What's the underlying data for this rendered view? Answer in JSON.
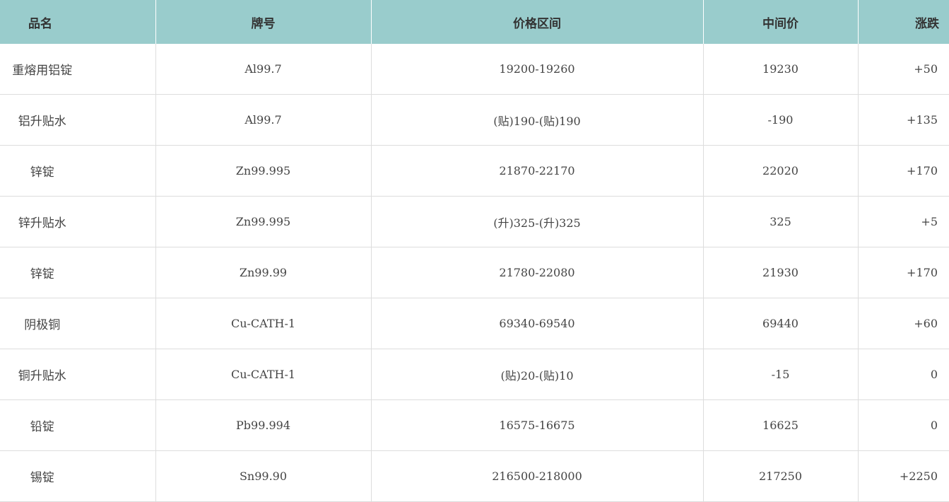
{
  "table": {
    "headers": {
      "name": "品名",
      "grade": "牌号",
      "range": "价格区间",
      "mid": "中间价",
      "change": "涨跌"
    },
    "rows": [
      {
        "name": "重熔用铝锭",
        "grade": "Al99.7",
        "range": "19200-19260",
        "mid": "19230",
        "change": "+50"
      },
      {
        "name": "铝升贴水",
        "grade": "Al99.7",
        "range": "(贴)190-(贴)190",
        "mid": "-190",
        "change": "+135"
      },
      {
        "name": "锌锭",
        "grade": "Zn99.995",
        "range": "21870-22170",
        "mid": "22020",
        "change": "+170"
      },
      {
        "name": "锌升贴水",
        "grade": "Zn99.995",
        "range": "(升)325-(升)325",
        "mid": "325",
        "change": "+5"
      },
      {
        "name": "锌锭",
        "grade": "Zn99.99",
        "range": "21780-22080",
        "mid": "21930",
        "change": "+170"
      },
      {
        "name": "阴极铜",
        "grade": "Cu-CATH-1",
        "range": "69340-69540",
        "mid": "69440",
        "change": "+60"
      },
      {
        "name": "铜升贴水",
        "grade": "Cu-CATH-1",
        "range": "(贴)20-(贴)10",
        "mid": "-15",
        "change": "0"
      },
      {
        "name": "铅锭",
        "grade": "Pb99.994",
        "range": "16575-16675",
        "mid": "16625",
        "change": "0"
      },
      {
        "name": "锡锭",
        "grade": "Sn99.90",
        "range": "216500-218000",
        "mid": "217250",
        "change": "+2250"
      }
    ]
  },
  "colors": {
    "header_bg": "#99cccc",
    "border": "#dddddd"
  }
}
